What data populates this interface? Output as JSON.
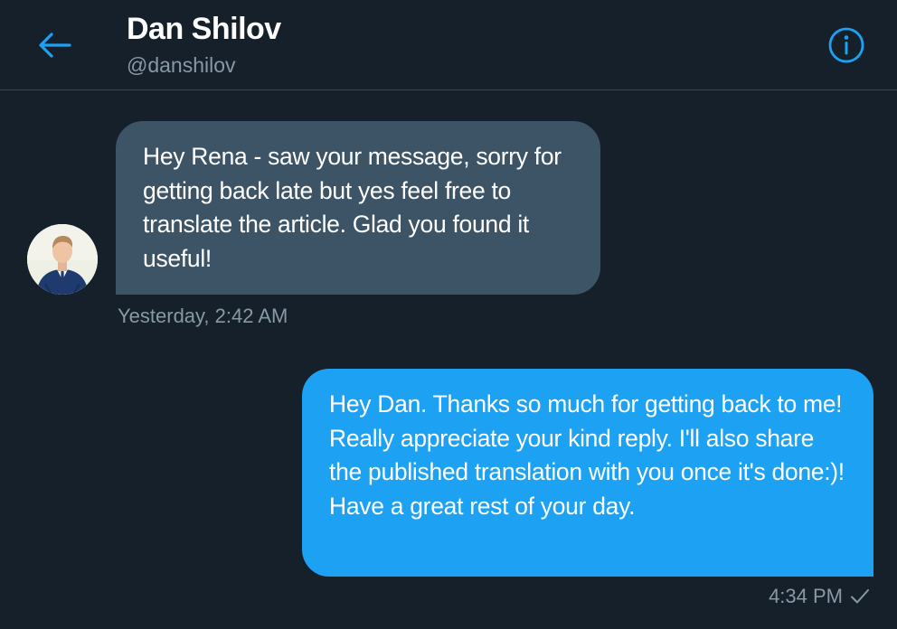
{
  "header": {
    "name": "Dan Shilov",
    "handle": "@danshilov",
    "back_icon": "arrow-left-icon",
    "info_icon": "info-icon"
  },
  "messages": [
    {
      "direction": "received",
      "text": "Hey Rena - saw your message, sorry for getting back late but yes feel free to translate the article. Glad you found it useful!",
      "time": "Yesterday, 2:42 AM"
    },
    {
      "direction": "sent",
      "text": "Hey Dan. Thanks so much for getting back to me! Really appreciate your kind reply. I'll also share the published translation with you once it's done:)! Have a great rest of your day.",
      "time": "4:34 PM",
      "status_icon": "checkmark-icon"
    }
  ],
  "colors": {
    "background": "#15202b",
    "accent": "#1da1f2",
    "received_bubble": "#3d5466",
    "secondary_text": "#8899a6",
    "divider": "#38444d"
  }
}
